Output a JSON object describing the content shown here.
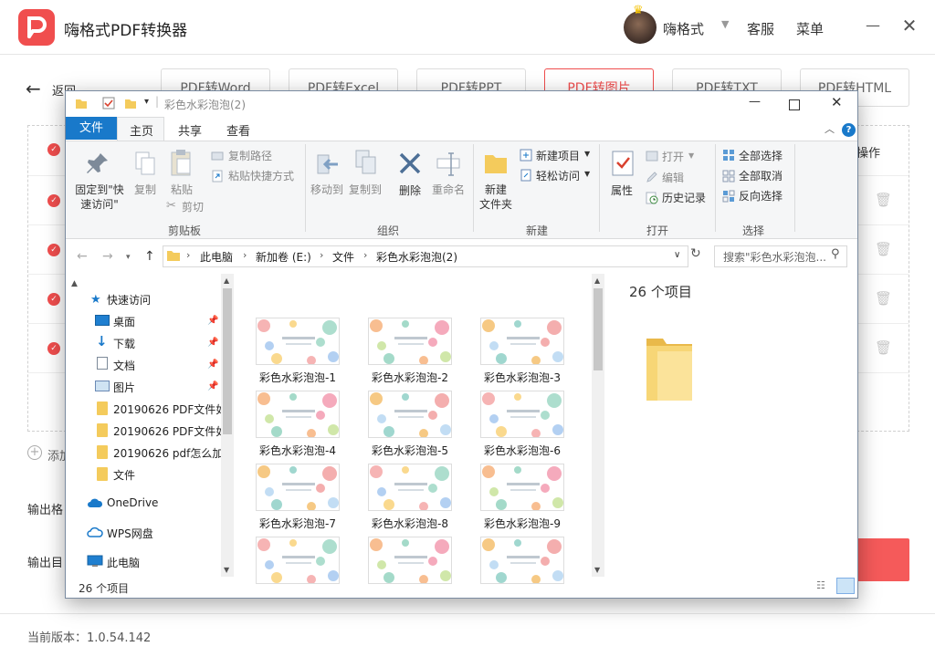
{
  "app": {
    "title": "嗨格式PDF转换器",
    "user": "嗨格式",
    "support": "客服",
    "menu": "菜单",
    "back": "返回",
    "tabs": [
      "PDF转Word",
      "PDF转Excel",
      "PDF转PPT",
      "PDF转图片",
      "PDF转TXT",
      "PDF转HTML"
    ],
    "active_tab": 3,
    "col_operation": "操作",
    "add_label": "添加",
    "output_format_label": "输出格",
    "output_dir_label": "输出目",
    "version": "当前版本：1.0.54.142",
    "accent": "#f04e4e"
  },
  "explorer": {
    "title": "彩色水彩泡泡(2)",
    "ribbon_tabs": [
      "文件",
      "主页",
      "共享",
      "查看"
    ],
    "ribbon": {
      "pin_quick_access": "固定到\"快\n速访问\"",
      "copy": "复制",
      "paste": "粘贴",
      "copy_path": "复制路径",
      "paste_shortcut": "粘贴快捷方式",
      "cut": "剪切",
      "clipboard_group": "剪贴板",
      "move_to": "移动到",
      "copy_to": "复制到",
      "delete": "删除",
      "rename": "重命名",
      "organize_group": "组织",
      "new_folder": "新建\n文件夹",
      "new_item": "新建项目",
      "easy_access": "轻松访问",
      "new_group": "新建",
      "properties": "属性",
      "open": "打开",
      "edit": "编辑",
      "history": "历史记录",
      "open_group": "打开",
      "select_all": "全部选择",
      "select_none": "全部取消",
      "invert_selection": "反向选择",
      "select_group": "选择"
    },
    "breadcrumb": [
      "此电脑",
      "新加卷 (E:)",
      "文件",
      "彩色水彩泡泡(2)"
    ],
    "search_placeholder": "搜索\"彩色水彩泡泡...",
    "nav": [
      {
        "label": "快速访问",
        "icon": "star-icon"
      },
      {
        "label": "桌面",
        "icon": "desktop-icon",
        "pinned": true
      },
      {
        "label": "下载",
        "icon": "download-icon",
        "pinned": true
      },
      {
        "label": "文档",
        "icon": "document-icon",
        "pinned": true
      },
      {
        "label": "图片",
        "icon": "picture-icon",
        "pinned": true
      },
      {
        "label": "20190626 PDF文件如",
        "icon": "folder-icon"
      },
      {
        "label": "20190626 PDF文件如",
        "icon": "folder-icon"
      },
      {
        "label": "20190626 pdf怎么加",
        "icon": "folder-icon"
      },
      {
        "label": "文件",
        "icon": "folder-icon"
      },
      {
        "label": "OneDrive",
        "icon": "cloud-icon"
      },
      {
        "label": "WPS网盘",
        "icon": "wps-cloud-icon"
      },
      {
        "label": "此电脑",
        "icon": "computer-icon"
      }
    ],
    "files": [
      "彩色水彩泡泡-1",
      "彩色水彩泡泡-2",
      "彩色水彩泡泡-3",
      "彩色水彩泡泡-4",
      "彩色水彩泡泡-5",
      "彩色水彩泡泡-6",
      "彩色水彩泡泡-7",
      "彩色水彩泡泡-8",
      "彩色水彩泡泡-9",
      "",
      "",
      ""
    ],
    "preview_count": "26 个项目",
    "status": "26 个项目"
  }
}
